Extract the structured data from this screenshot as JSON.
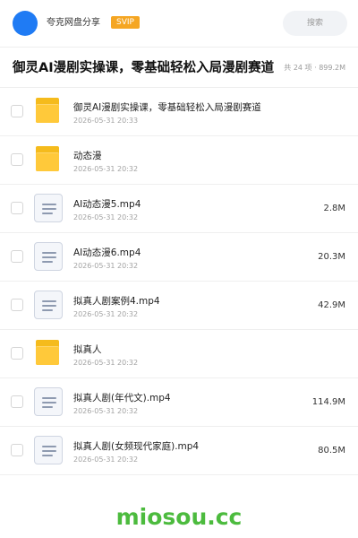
{
  "header": {
    "app_name": "夸克网盘分享",
    "badge": "SVIP",
    "search_placeholder": "搜索"
  },
  "share": {
    "title": "御灵AI漫剧实操课，零基础轻松入局漫剧赛道",
    "stats": "共 24 项 · 899.2M"
  },
  "files": [
    {
      "type": "folder",
      "name": "御灵AI漫剧实操课，零基础轻松入局漫剧赛道",
      "date": "2026-05-31 20:33",
      "size": ""
    },
    {
      "type": "folder",
      "name": "动态漫",
      "date": "2026-05-31 20:32",
      "size": ""
    },
    {
      "type": "file",
      "name": "AI动态漫5.mp4",
      "date": "2026-05-31 20:32",
      "size": "2.8M"
    },
    {
      "type": "file",
      "name": "AI动态漫6.mp4",
      "date": "2026-05-31 20:32",
      "size": "20.3M"
    },
    {
      "type": "file",
      "name": "拟真人剧案例4.mp4",
      "date": "2026-05-31 20:32",
      "size": "42.9M"
    },
    {
      "type": "folder",
      "name": "拟真人",
      "date": "2026-05-31 20:32",
      "size": ""
    },
    {
      "type": "file",
      "name": "拟真人剧(年代文).mp4",
      "date": "2026-05-31 20:32",
      "size": "114.9M"
    },
    {
      "type": "file",
      "name": "拟真人剧(女频现代家庭).mp4",
      "date": "2026-05-31 20:32",
      "size": "80.5M"
    }
  ],
  "footer": {
    "watermark": "miosou.cc"
  },
  "colors": {
    "avatar": "#1f7bf4",
    "badge": "#f5a623",
    "folder": "#ffc93a",
    "watermark": "#4cbb3e"
  }
}
